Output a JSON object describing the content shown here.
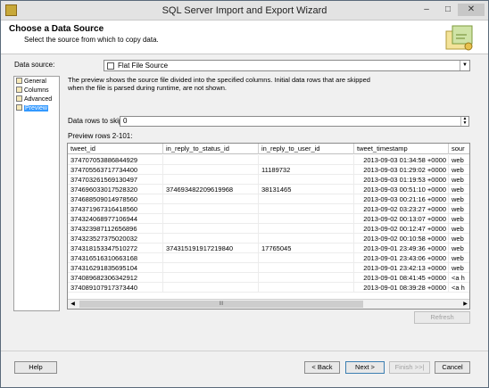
{
  "window": {
    "title": "SQL Server Import and Export Wizard",
    "minimize": "–",
    "maximize": "□",
    "close": "✕"
  },
  "header": {
    "title": "Choose a Data Source",
    "subtitle": "Select the source from which to copy data."
  },
  "data_source": {
    "label": "Data source:",
    "value": "Flat File Source",
    "icon": "flat-file-icon"
  },
  "nav": [
    {
      "label": "General",
      "icon": "general-icon",
      "selected": false
    },
    {
      "label": "Columns",
      "icon": "columns-icon",
      "selected": false
    },
    {
      "label": "Advanced",
      "icon": "advanced-icon",
      "selected": false
    },
    {
      "label": "Preview",
      "icon": "preview-icon",
      "selected": true
    }
  ],
  "preview": {
    "description": "The preview shows the source file divided into the specified columns. Initial data rows that are skipped when the file is parsed during runtime, are not shown.",
    "skip_label": "Data rows to skip:",
    "skip_value": "0",
    "rows_label": "Preview rows 2-101:",
    "columns": [
      "tweet_id",
      "in_reply_to_status_id",
      "in_reply_to_user_id",
      "tweet_timestamp",
      "sour"
    ],
    "rows": [
      [
        "374707053886844929",
        "",
        "",
        "2013-09-03 01:34:58 +0000",
        "web"
      ],
      [
        "374705563717734400",
        "",
        "11189732",
        "2013-09-03 01:29:02 +0000",
        "web"
      ],
      [
        "374703261569130497",
        "",
        "",
        "2013-09-03 01:19:53 +0000",
        "web"
      ],
      [
        "374696033017528320",
        "374693482209619968",
        "38131465",
        "2013-09-03 00:51:10 +0000",
        "web"
      ],
      [
        "374688509014978560",
        "",
        "",
        "2013-09-03 00:21:16 +0000",
        "web"
      ],
      [
        "374371967316418560",
        "",
        "",
        "2013-09-02 03:23:27 +0000",
        "web"
      ],
      [
        "374324068977106944",
        "",
        "",
        "2013-09-02 00:13:07 +0000",
        "web"
      ],
      [
        "374323987112656896",
        "",
        "",
        "2013-09-02 00:12:47 +0000",
        "web"
      ],
      [
        "374323527375020032",
        "",
        "",
        "2013-09-02 00:10:58 +0000",
        "web"
      ],
      [
        "374318153347510272",
        "374315191917219840",
        "17765045",
        "2013-09-01 23:49:36 +0000",
        "web"
      ],
      [
        "374316516310663168",
        "",
        "",
        "2013-09-01 23:43:06 +0000",
        "web"
      ],
      [
        "374316291835695104",
        "",
        "",
        "2013-09-01 23:42:13 +0000",
        "web"
      ],
      [
        "374089682306342912",
        "",
        "",
        "2013-09-01 08:41:45 +0000",
        "<a h"
      ],
      [
        "374089107917373440",
        "",
        "",
        "2013-09-01 08:39:28 +0000",
        "<a h"
      ]
    ],
    "scroll_thumb": "III",
    "refresh": "Refresh"
  },
  "buttons": {
    "help": "Help",
    "back": "< Back",
    "next": "Next >",
    "finish": "Finish >>|",
    "cancel": "Cancel"
  }
}
